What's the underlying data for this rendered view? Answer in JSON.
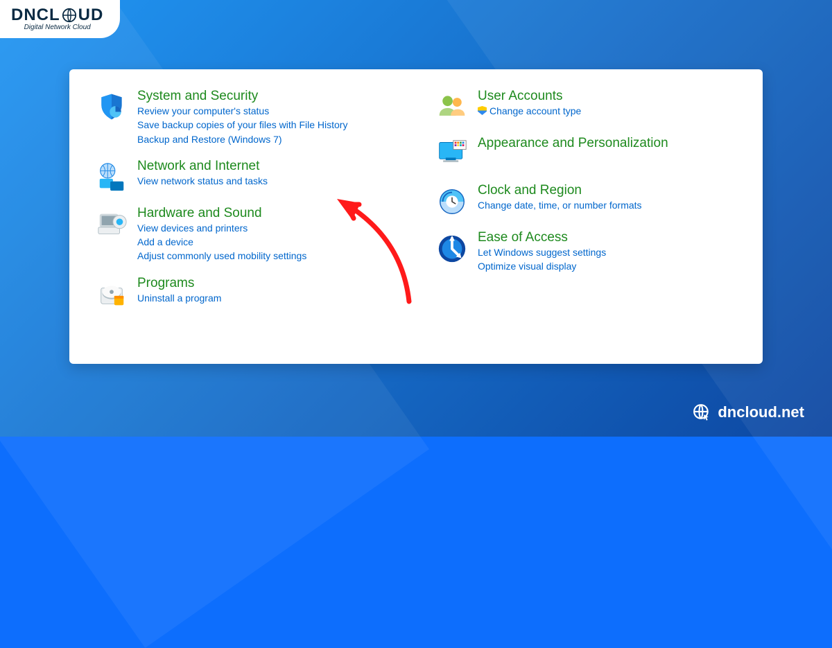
{
  "brand": {
    "name_a": "DNCL",
    "name_b": "UD",
    "sub": "Digital Network Cloud",
    "footer": "dncloud.net"
  },
  "left": [
    {
      "icon": "shield",
      "title": "System and Security",
      "links": [
        "Review your computer's status",
        "Save backup copies of your files with File History",
        "Backup and Restore (Windows 7)"
      ]
    },
    {
      "icon": "network",
      "title": "Network and Internet",
      "links": [
        "View network status and tasks"
      ]
    },
    {
      "icon": "hardware",
      "title": "Hardware and Sound",
      "links": [
        "View devices and printers",
        "Add a device",
        "Adjust commonly used mobility settings"
      ]
    },
    {
      "icon": "programs",
      "title": "Programs",
      "links": [
        "Uninstall a program"
      ]
    }
  ],
  "right": [
    {
      "icon": "users",
      "title": "User Accounts",
      "links": [
        {
          "text": "Change account type",
          "shield": true
        }
      ]
    },
    {
      "icon": "appearance",
      "title": "Appearance and Personalization",
      "links": []
    },
    {
      "icon": "clock",
      "title": "Clock and Region",
      "links": [
        "Change date, time, or number formats"
      ]
    },
    {
      "icon": "access",
      "title": "Ease of Access",
      "links": [
        "Let Windows suggest settings",
        "Optimize visual display"
      ]
    }
  ]
}
